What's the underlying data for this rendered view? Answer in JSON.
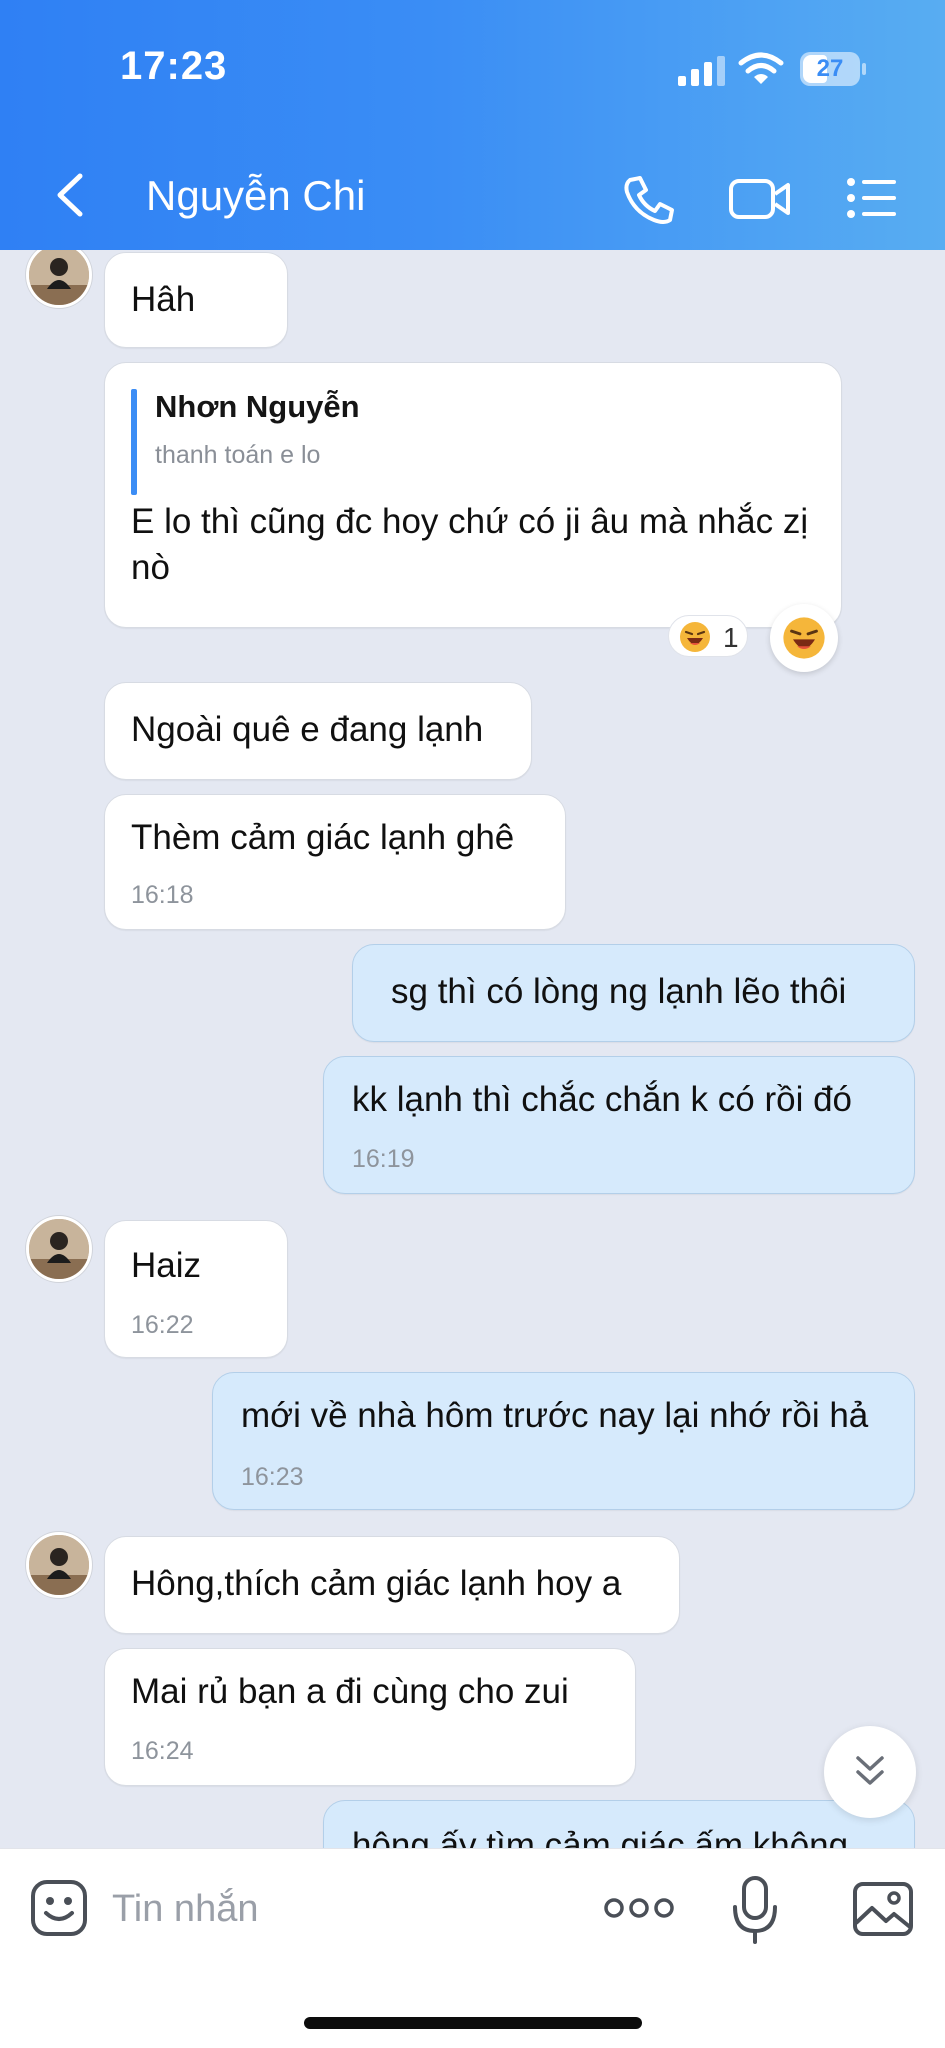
{
  "status_bar": {
    "time": "17:23",
    "battery": "27",
    "icons": [
      "signal-icon",
      "wifi-icon",
      "battery-icon"
    ]
  },
  "header": {
    "title": "Nguyễn Chi",
    "icons": [
      "back-arrow-icon",
      "phone-icon",
      "video-call-icon",
      "menu-list-icon"
    ]
  },
  "messages": [
    {
      "direction": "in",
      "text": "Hâh",
      "time": ""
    },
    {
      "direction": "in",
      "reply_to": {
        "name": "Nhơn Nguyễn",
        "text": "thanh toán e lo"
      },
      "text": "E lo thì cũng đc hoy chứ có ji âu mà nhắc zị nò",
      "reaction": {
        "emoji": "laughing-face-icon",
        "count": "1"
      }
    },
    {
      "direction": "in",
      "text": "Ngoài quê e đang lạnh",
      "time": ""
    },
    {
      "direction": "in",
      "text": "Thèm cảm giác lạnh ghê",
      "time": "16:18"
    },
    {
      "direction": "out",
      "text": "sg thì có lòng ng lạnh lẽo thôi",
      "time": ""
    },
    {
      "direction": "out",
      "text": "kk lạnh thì chắc chắn k có rồi đó",
      "time": "16:19"
    },
    {
      "direction": "in",
      "text": "Haiz",
      "time": "16:22"
    },
    {
      "direction": "out",
      "text": "mới về nhà hôm trước nay lại nhớ rồi hả",
      "time": "16:23"
    },
    {
      "direction": "in",
      "text": "Hông,thích cảm giác lạnh hoy a",
      "time": ""
    },
    {
      "direction": "in",
      "text": "Mai  rủ bạn a đi cùng cho zui",
      "time": "16:24"
    },
    {
      "direction": "out",
      "text": "hông ấy tìm cảm giác ấm không",
      "time": ""
    }
  ],
  "composer": {
    "placeholder": "Tin nhắn",
    "icons": [
      "emoji-sticker-icon",
      "more-options-icon",
      "microphone-icon",
      "image-gallery-icon"
    ]
  },
  "colors": {
    "header_gradient_start": "#2f80f4",
    "header_gradient_end": "#58adf2",
    "chat_background": "#e4e8f2",
    "incoming_bubble": "#ffffff",
    "outgoing_bubble": "#d6eafc",
    "reply_accent": "#3b8df5",
    "timestamp": "#8e949c"
  }
}
